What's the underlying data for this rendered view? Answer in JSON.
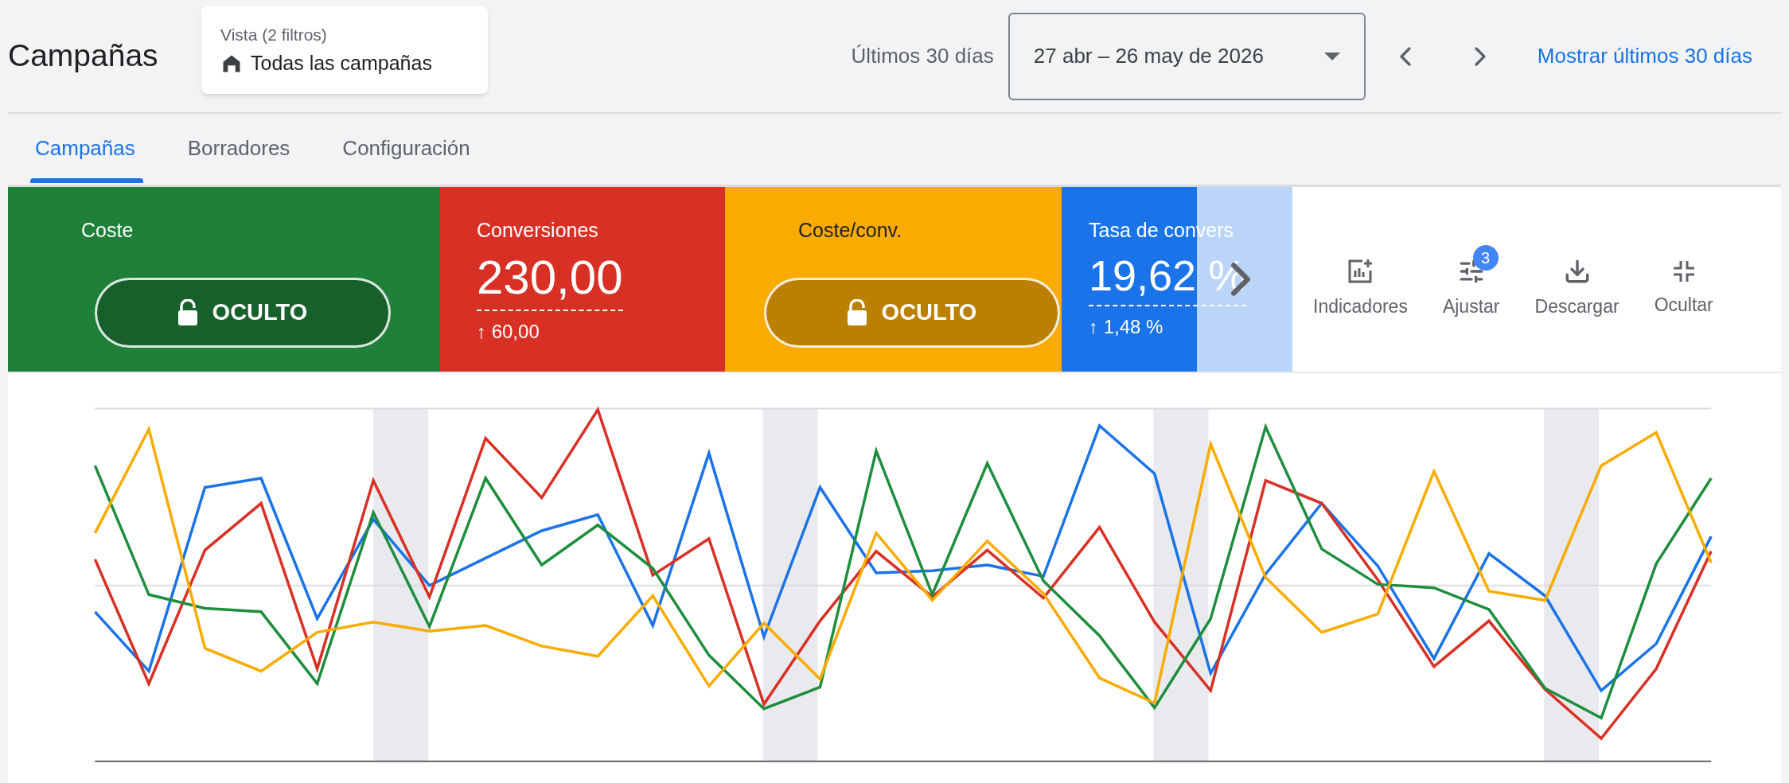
{
  "title": "Campañas",
  "view": {
    "label": "Vista (2 filtros)",
    "value": "Todas las campañas"
  },
  "date_range": {
    "label": "Últimos 30 días",
    "value": "27 abr – 26 may de 2026"
  },
  "link": "Mostrar últimos 30 días",
  "tabs": [
    {
      "label": "Campañas",
      "selected": true
    },
    {
      "label": "Borradores",
      "selected": false
    },
    {
      "label": "Configuración",
      "selected": false
    }
  ],
  "metrics": [
    {
      "kind": "hidden",
      "label": "Coste",
      "value": "OCULTO",
      "color": "#1e8039"
    },
    {
      "kind": "value",
      "label": "Conversiones",
      "value": "230,00",
      "delta": "↑ 60,00",
      "color": "#d93025"
    },
    {
      "kind": "hidden",
      "label": "Coste/conv.",
      "value": "OCULTO",
      "color": "#f9ab00"
    },
    {
      "kind": "value",
      "label": "Tasa de convers",
      "value": "19,62 %",
      "delta": "↑ 1,48 %",
      "color": "#1a73e8"
    }
  ],
  "metrics_scroll_right": true,
  "toolbar": [
    {
      "kind": "metrics",
      "label": "Indicadores"
    },
    {
      "kind": "adjust",
      "label": "Ajustar",
      "badge": "3"
    },
    {
      "kind": "download",
      "label": "Descargar"
    },
    {
      "kind": "collapse",
      "label": "Ocultar"
    }
  ]
}
